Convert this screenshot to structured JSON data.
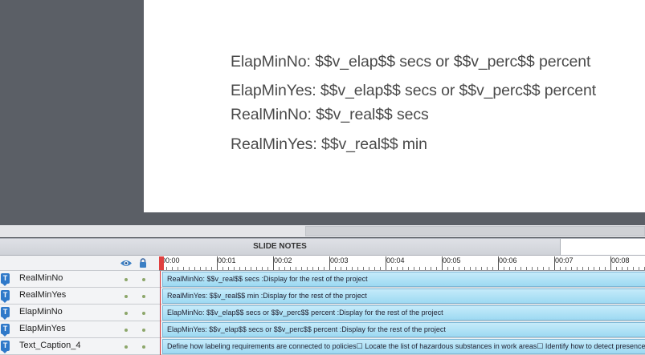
{
  "slide": {
    "captions": [
      "ElapMinNo: $$v_elap$$ secs or $$v_perc$$ percent",
      "ElapMinYes: $$v_elap$$ secs or $$v_perc$$ percent",
      "RealMinNo: $$v_real$$ secs",
      "RealMinYes: $$v_real$$ min"
    ]
  },
  "notes_bar": {
    "label": "SLIDE NOTES"
  },
  "timeline": {
    "ruler_ticks": [
      "00:00",
      "00:01",
      "00:02",
      "00:03",
      "00:04",
      "00:05",
      "00:06",
      "00:07",
      "00:08"
    ],
    "rows": [
      {
        "name": "RealMinNo",
        "bar_text": "RealMinNo: $$v_real$$ secs :Display for the rest of the project"
      },
      {
        "name": "RealMinYes",
        "bar_text": "RealMinYes: $$v_real$$ min :Display for the rest of the project"
      },
      {
        "name": "ElapMinNo",
        "bar_text": "ElapMinNo: $$v_elap$$ secs or $$v_perc$$ percent :Display for the rest of the project"
      },
      {
        "name": "ElapMinYes",
        "bar_text": "ElapMinYes: $$v_elap$$ secs or $$v_perc$$ percent :Display for the rest of the project"
      },
      {
        "name": "Text_Caption_4",
        "bar_text": "Define how labeling requirements are connected to policies☐ Locate the list of hazardous substances in work areas☐ Identify how to detect presence"
      }
    ]
  },
  "colors": {
    "stage_bg": "#5b5f66",
    "bar_fill": "#9dd9f2",
    "playhead": "#e0403f",
    "caption_icon": "#2f79c9"
  }
}
